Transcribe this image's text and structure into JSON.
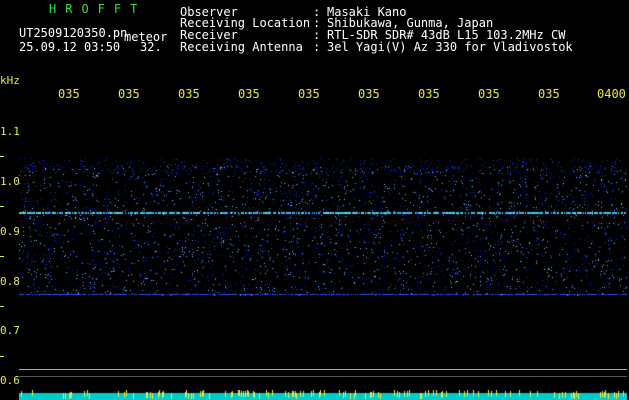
{
  "header": {
    "logo": "HROFFT",
    "filename": "UT2509120350.pn",
    "meteor_label": "meteor",
    "datetime": "25.09.12 03:50",
    "count": "32.",
    "fields": [
      {
        "label": "Observer",
        "value": "Masaki Kano"
      },
      {
        "label": "Receiving Location",
        "value": "Shibukawa, Gunma, Japan"
      },
      {
        "label": "Receiver",
        "value": "RTL-SDR SDR# 43dB L15 103.2MHz CW"
      },
      {
        "label": "Receiving Antenna",
        "value": "3el Yagi(V) Az 330 for Vladivostok"
      }
    ],
    "separator": ":"
  },
  "axes": {
    "y_unit": "kHz",
    "y_ticks": [
      "1.1",
      "1.0",
      "0.9",
      "0.8",
      "0.7",
      "0.6"
    ],
    "x_ticks": [
      "035",
      "035",
      "035",
      "035",
      "035",
      "035",
      "035",
      "035",
      "035",
      "0400"
    ]
  },
  "colors": {
    "background": "#000000",
    "noise_band": "#1a3cff",
    "signal_line": "#55dddd",
    "axis_text": "#e8e84a",
    "header_text": "#ffffff",
    "logo": "#33dd44",
    "baseline": "#00cccc"
  }
}
